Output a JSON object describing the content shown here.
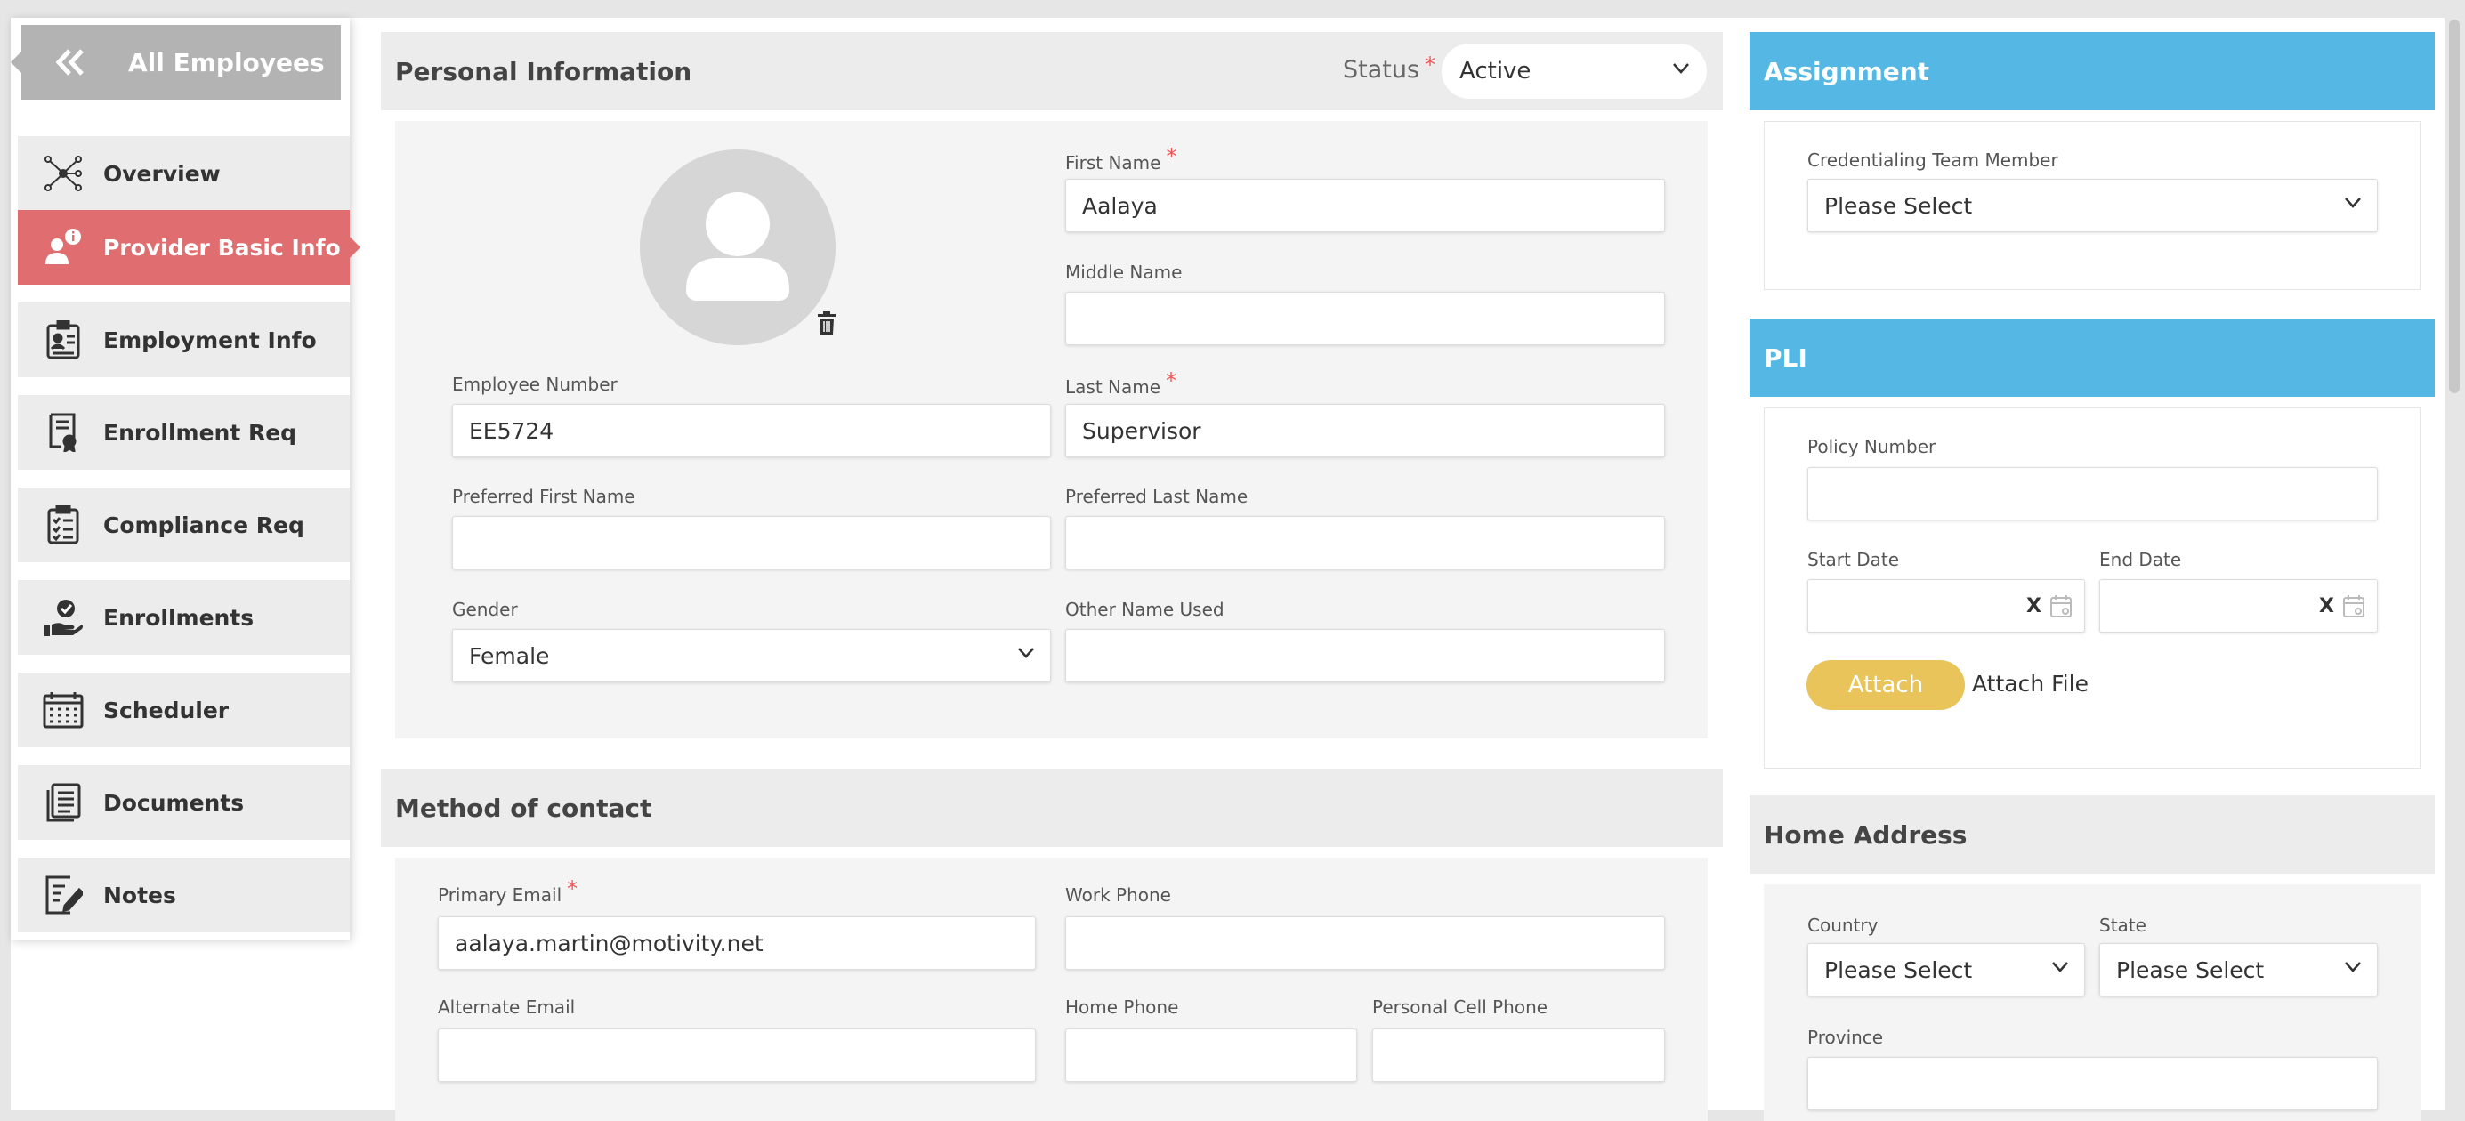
{
  "sidebar": {
    "back_label": "All Employees",
    "items": [
      {
        "label": "Overview",
        "icon": "network-icon"
      },
      {
        "label": "Provider Basic Info",
        "icon": "user-info-icon",
        "active": true
      },
      {
        "label": "Employment Info",
        "icon": "id-badge-icon"
      },
      {
        "label": "Enrollment Req",
        "icon": "certificate-icon"
      },
      {
        "label": "Compliance Req",
        "icon": "checklist-icon"
      },
      {
        "label": "Enrollments",
        "icon": "hand-check-icon"
      },
      {
        "label": "Scheduler",
        "icon": "calendar-icon"
      },
      {
        "label": "Documents",
        "icon": "document-icon"
      },
      {
        "label": "Notes",
        "icon": "note-edit-icon"
      }
    ]
  },
  "personal": {
    "title": "Personal Information",
    "status_label": "Status",
    "status_value": "Active",
    "first_name_label": "First Name",
    "first_name": "Aalaya",
    "middle_name_label": "Middle Name",
    "middle_name": "",
    "employee_number_label": "Employee Number",
    "employee_number": "EE5724",
    "last_name_label": "Last Name",
    "last_name": "Supervisor",
    "pref_first_label": "Preferred First Name",
    "pref_first": "",
    "pref_last_label": "Preferred Last Name",
    "pref_last": "",
    "gender_label": "Gender",
    "gender": "Female",
    "other_name_label": "Other Name Used",
    "other_name": ""
  },
  "contact": {
    "title": "Method of contact",
    "primary_email_label": "Primary Email",
    "primary_email": "aalaya.martin@motivity.net",
    "work_phone_label": "Work Phone",
    "alternate_email_label": "Alternate Email",
    "home_phone_label": "Home Phone",
    "cell_phone_label": "Personal Cell Phone"
  },
  "assignment": {
    "title": "Assignment",
    "team_member_label": "Credentialing Team Member",
    "team_member_value": "Please Select"
  },
  "pli": {
    "title": "PLI",
    "policy_label": "Policy Number",
    "start_label": "Start Date",
    "end_label": "End Date",
    "clear_glyph": "X",
    "attach_button": "Attach",
    "attach_file": "Attach File"
  },
  "home_address": {
    "title": "Home Address",
    "country_label": "Country",
    "country_value": "Please Select",
    "state_label": "State",
    "state_value": "Please Select",
    "province_label": "Province"
  },
  "colors": {
    "active_nav": "#e06d6f",
    "section_blue": "#55b8e4",
    "attach_yellow": "#e8c45a"
  }
}
